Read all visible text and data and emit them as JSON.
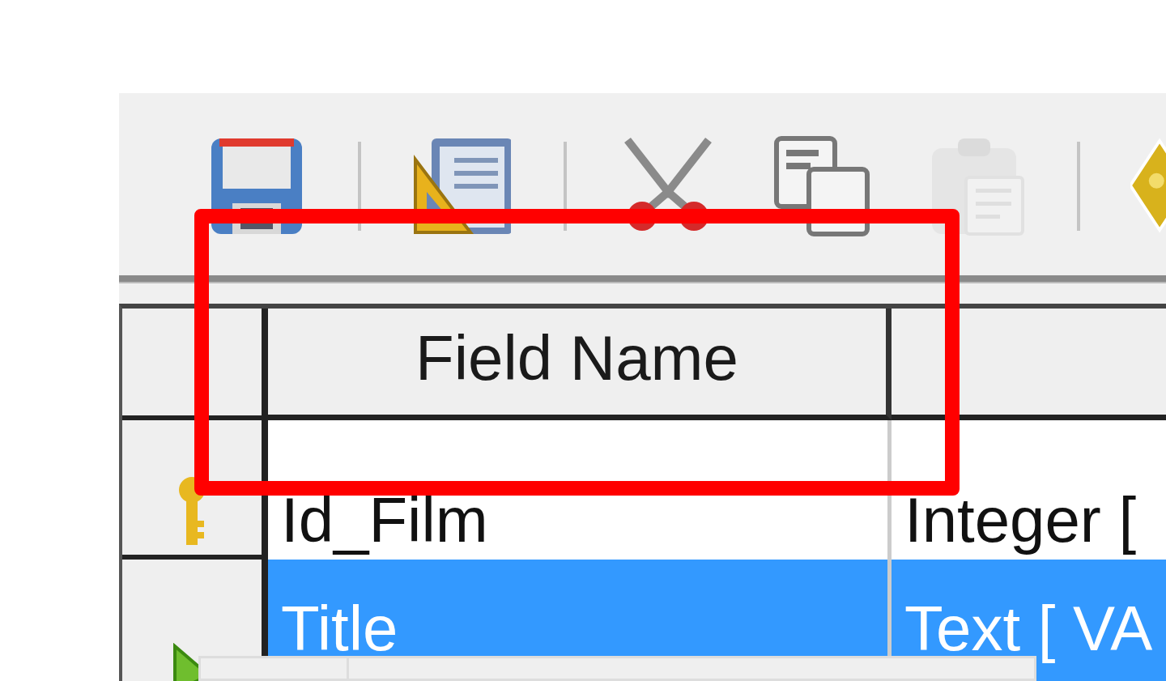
{
  "toolbar": {
    "buttons": [
      {
        "kind": "save",
        "disabled": false
      },
      {
        "kind": "separator"
      },
      {
        "kind": "design",
        "disabled": false
      },
      {
        "kind": "separator"
      },
      {
        "kind": "cut",
        "disabled": false
      },
      {
        "kind": "copy",
        "disabled": false
      },
      {
        "kind": "paste",
        "disabled": true
      },
      {
        "kind": "separator"
      },
      {
        "kind": "primary-key",
        "disabled": false
      }
    ]
  },
  "table": {
    "columns": [
      "Field Name"
    ],
    "rows": [
      {
        "kind": "key",
        "field_name": "Id_Film",
        "field_type": "Integer [",
        "selected": false
      },
      {
        "kind": "current",
        "field_name": "Title",
        "field_type": "Text [ VA",
        "selected": true
      }
    ]
  }
}
